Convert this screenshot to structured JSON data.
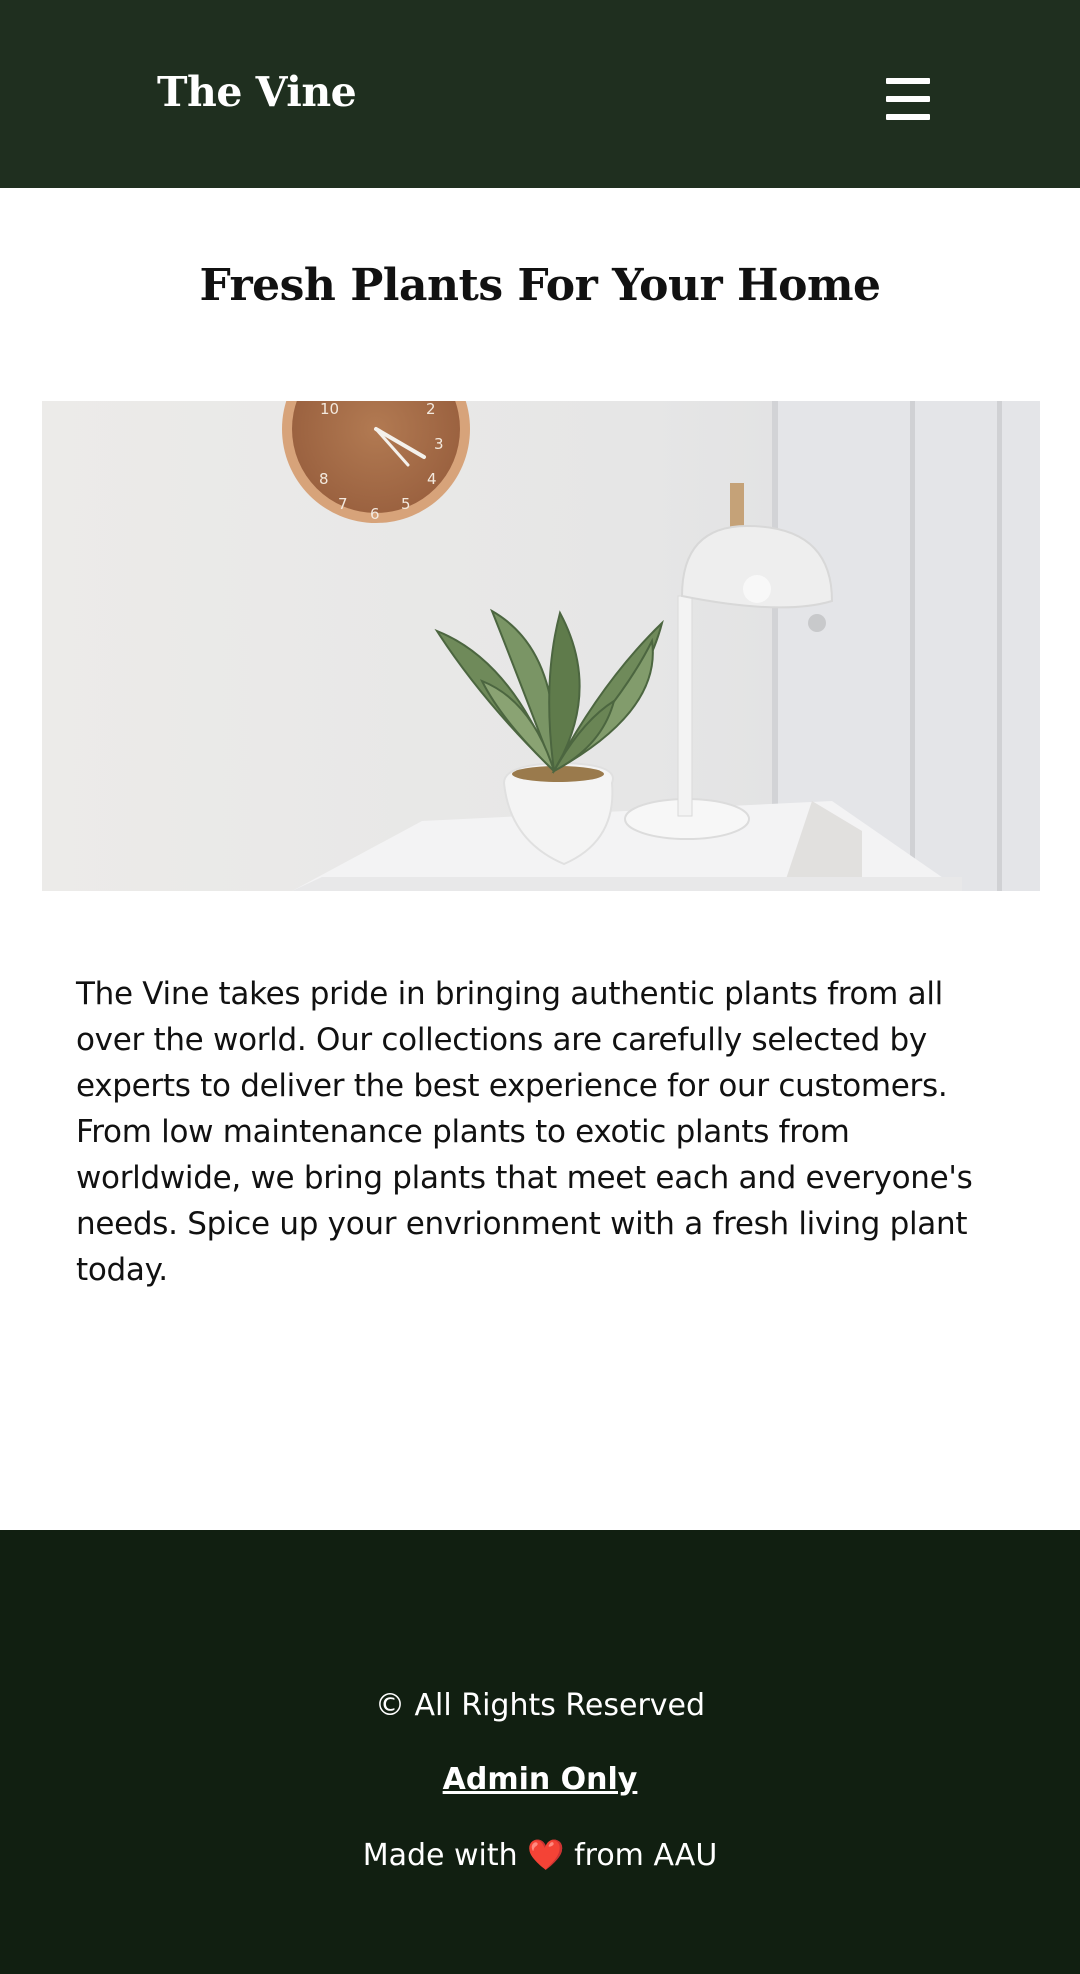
{
  "header": {
    "brand": "The Vine",
    "menu_icon": "hamburger-menu-icon",
    "background": "#1f2f1f"
  },
  "main": {
    "title": "Fresh Plants For Your Home",
    "hero_image": "potted plant on white shelf with wall clock and desk lamp",
    "intro": "The Vine takes pride in bringing authentic plants from all over the world. Our collections are carefully selected by experts to deliver the best experience for our customers. From low maintenance plants to exotic plants from worldwide, we bring plants that meet each and everyone's needs. Spice up your envrionment with a fresh living plant today."
  },
  "footer": {
    "rights": "© All Rights Reserved",
    "admin_link": "Admin Only",
    "made_prefix": "Made with",
    "heart": "❤️",
    "made_suffix": "from AAU",
    "background": "#111f11"
  }
}
